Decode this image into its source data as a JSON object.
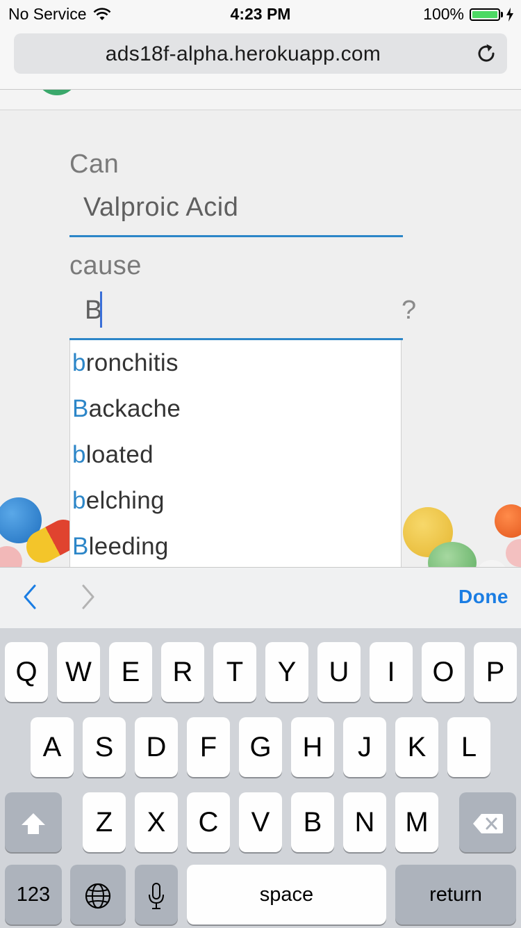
{
  "status_bar": {
    "carrier": "No Service",
    "time": "4:23 PM",
    "battery_percent": "100%",
    "battery_level": 1.0
  },
  "browser": {
    "url": "ads18f-alpha.herokuapp.com",
    "reload_icon": "reload-icon"
  },
  "form": {
    "label_drug": "Can",
    "drug_value": "Valproic Acid",
    "label_cause": "cause",
    "cause_value": "B",
    "question_mark": "?"
  },
  "suggestions": [
    {
      "match": "b",
      "rest": "ronchitis"
    },
    {
      "match": "B",
      "rest": "ackache"
    },
    {
      "match": "b",
      "rest": "loated"
    },
    {
      "match": "b",
      "rest": "elching"
    },
    {
      "match": "B",
      "rest": "leeding"
    }
  ],
  "accessory_bar": {
    "prev_icon": "chevron-left-icon",
    "next_icon": "chevron-right-icon",
    "done_label": "Done"
  },
  "keyboard": {
    "row1": [
      "Q",
      "W",
      "E",
      "R",
      "T",
      "Y",
      "U",
      "I",
      "O",
      "P"
    ],
    "row2": [
      "A",
      "S",
      "D",
      "F",
      "G",
      "H",
      "J",
      "K",
      "L"
    ],
    "row3": [
      "Z",
      "X",
      "C",
      "V",
      "B",
      "N",
      "M"
    ],
    "numbers_label": "123",
    "space_label": "space",
    "return_label": "return",
    "shift_icon": "shift-icon",
    "delete_icon": "backspace-icon",
    "globe_icon": "globe-icon",
    "mic_icon": "microphone-icon"
  },
  "colors": {
    "accent_blue": "#2c86c8",
    "done_blue": "#1a7de3",
    "battery_green": "#4cd964"
  }
}
